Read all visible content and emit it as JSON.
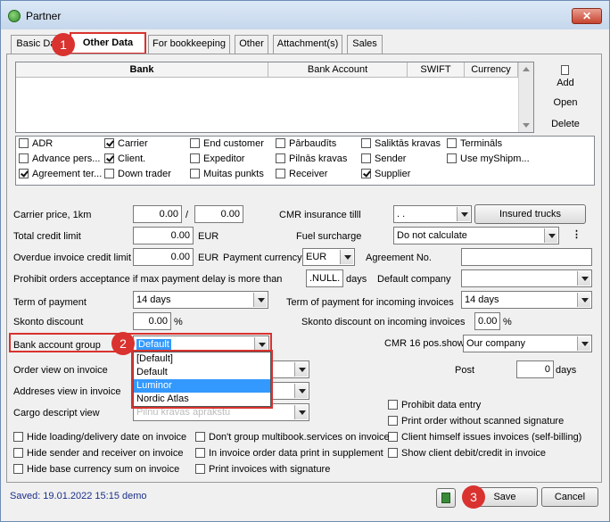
{
  "window": {
    "title": "Partner",
    "close_label": "✕"
  },
  "tabs": [
    {
      "label": "Basic Data"
    },
    {
      "label": "Other Data"
    },
    {
      "label": "For bookkeeping"
    },
    {
      "label": "Other"
    },
    {
      "label": "Attachment(s)"
    },
    {
      "label": "Sales"
    }
  ],
  "bank_grid": {
    "columns": [
      "Bank",
      "Bank Account",
      "SWIFT",
      "Currency"
    ]
  },
  "side_buttons": {
    "add": "Add",
    "open": "Open",
    "delete": "Delete"
  },
  "checkboxes": [
    {
      "label": "ADR",
      "checked": false
    },
    {
      "label": "Carrier",
      "checked": true
    },
    {
      "label": "End customer",
      "checked": false
    },
    {
      "label": "Pārbaudīts",
      "checked": false
    },
    {
      "label": "Saliktās kravas",
      "checked": false
    },
    {
      "label": "Termināls",
      "checked": false
    },
    {
      "label": "Advance pers...",
      "checked": false
    },
    {
      "label": "Client.",
      "checked": true
    },
    {
      "label": "Expeditor",
      "checked": false
    },
    {
      "label": "Pilnās kravas",
      "checked": false
    },
    {
      "label": "Sender",
      "checked": false
    },
    {
      "label": "Use myShipm...",
      "checked": false
    },
    {
      "label": "Agreement ter...",
      "checked": true
    },
    {
      "label": "Down trader",
      "checked": false
    },
    {
      "label": "Muitas punkts",
      "checked": false
    },
    {
      "label": "Receiver",
      "checked": false
    },
    {
      "label": "Supplier",
      "checked": true
    }
  ],
  "form": {
    "carrier_price_label": "Carrier price, 1km",
    "carrier_price_1": "0.00",
    "slash": "/",
    "carrier_price_2": "0.00",
    "cmr_insurance_label": "CMR insurance tilll",
    "cmr_insurance_value": ". .",
    "insured_trucks_button": "Insured trucks",
    "total_credit_label": "Total credit limit",
    "total_credit_value": "0.00",
    "currency_eur": "EUR",
    "fuel_surcharge_label": "Fuel surcharge",
    "fuel_surcharge_value": "Do not calculate",
    "more_icon": "⋮",
    "overdue_label": "Overdue invoice credit limit",
    "overdue_value": "0.00",
    "overdue_currency": "EUR",
    "payment_currency_label": "Payment currency",
    "payment_currency_value": "EUR",
    "agreement_no_label": "Agreement No.",
    "agreement_no_value": "",
    "prohibit_label": "Prohibit orders acceptance if max payment delay is more than",
    "prohibit_value": ".NULL.",
    "days_label": "days",
    "default_company_label": "Default company",
    "default_company_value": "",
    "term_payment_label": "Term of payment",
    "term_payment_value": "14 days",
    "term_incoming_label": "Term of payment for incoming invoices",
    "term_incoming_value": "14 days",
    "skonto_label": "Skonto discount",
    "skonto_value": "0.00",
    "percent": "%",
    "skonto_incoming_label": "Skonto discount on incoming invoices",
    "skonto_incoming_value": "0.00",
    "bank_group_label": "Bank account group",
    "bank_group_value": "Default",
    "cmr16_label": "CMR 16 pos.show",
    "cmr16_value": "Our company",
    "order_view_label": "Order view on invoice",
    "post_label": "Post",
    "post_value": "0",
    "post_days": "days",
    "addresses_view_label": "Addreses view in invoice",
    "cargo_view_label": "Cargo descript view",
    "cargo_view_value": "Pilnu kravas aprakstu"
  },
  "bank_group_dropdown": {
    "options": [
      "[Default]",
      "Default",
      "Luminor",
      "Nordic Atlas"
    ],
    "highlighted": "Luminor"
  },
  "right_checks": [
    {
      "label": "Prohibit data entry",
      "checked": false
    },
    {
      "label": "Print order without scanned signature",
      "checked": false
    },
    {
      "label": "Client himself issues invoices (self-billing)",
      "checked": false
    },
    {
      "label": "Show client debit/credit in invoice",
      "checked": false
    }
  ],
  "bottom_checks": [
    {
      "label": "Hide loading/delivery date on invoice",
      "checked": false
    },
    {
      "label": "Don't group multibook.services on invoice",
      "checked": false
    },
    {
      "label": "Hide sender and receiver on invoice",
      "checked": false
    },
    {
      "label": "In invoice order data print in supplement",
      "checked": false
    },
    {
      "label": "Hide base currency sum on invoice",
      "checked": false
    },
    {
      "label": "Print invoices with signature",
      "checked": false
    }
  ],
  "footer": {
    "status": "Saved: 19.01.2022 15:15 demo",
    "save_button": "Save",
    "cancel_button": "Cancel"
  },
  "annotations": {
    "badge1": "1",
    "badge2": "2",
    "badge3": "3"
  },
  "colors": {
    "annotation_red": "#d9322f",
    "selection_blue": "#3399ff",
    "titlebar": "#c6d7ec"
  }
}
